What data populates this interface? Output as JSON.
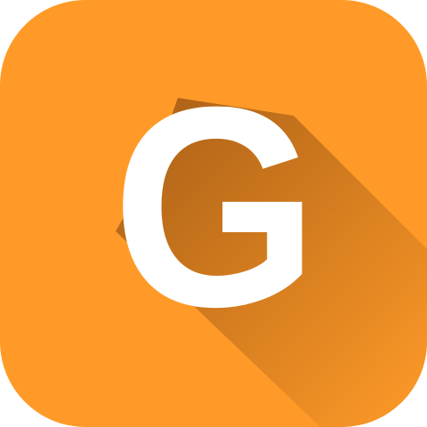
{
  "icon": {
    "letter": "G",
    "background_color": "#FF9A28",
    "letter_color": "#FFFFFF",
    "shadow_color": "#8A4A10"
  }
}
